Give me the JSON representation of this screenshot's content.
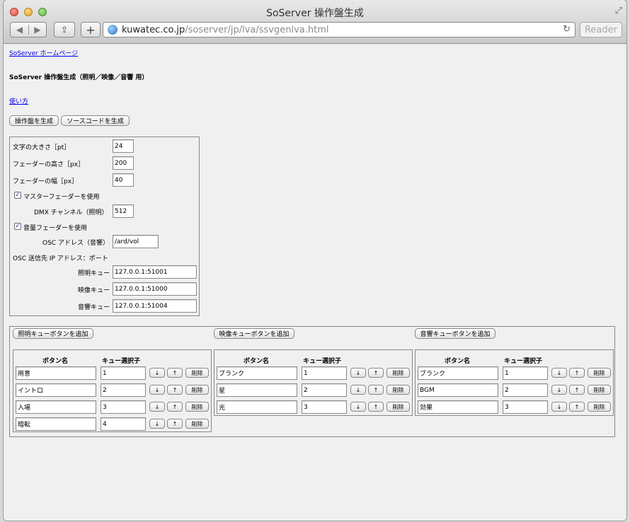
{
  "window": {
    "title": "SoServer 操作盤生成"
  },
  "toolbar": {
    "url_host": "kuwatec.co.jp",
    "url_path": "/soserver/jp/lva/ssvgenlva.html",
    "reader_label": "Reader",
    "add_label": "+",
    "back_glyph": "◀",
    "forward_glyph": "▶"
  },
  "page": {
    "home_link": "SoServer ホームページ",
    "heading": "SoServer 操作盤生成（照明／映像／音響 用）",
    "howto_link": "使い方",
    "generate_panel_button": "操作盤を生成",
    "generate_source_button": "ソースコードを生成"
  },
  "settings": {
    "font_size_label": "文字の大きさ［pt］",
    "font_size_value": "24",
    "fader_height_label": "フェーダーの高さ［px］",
    "fader_height_value": "200",
    "fader_width_label": "フェーダーの幅［px］",
    "fader_width_value": "40",
    "master_fader_label": "マスターフェーダーを使用",
    "master_fader_checked": true,
    "dmx_label": "DMX チャンネル（照明）",
    "dmx_value": "512",
    "volume_fader_label": "音量フェーダーを使用",
    "volume_fader_checked": true,
    "osc_address_label": "OSC アドレス（音響）",
    "osc_address_value": "/ard/vol",
    "osc_dest_label": "OSC 送信先 IP アドレス：ポート",
    "lighting_cue_label": "照明キュー",
    "lighting_cue_value": "127.0.0.1:51001",
    "video_cue_label": "映像キュー",
    "video_cue_value": "127.0.0.1:51000",
    "sound_cue_label": "音響キュー",
    "sound_cue_value": "127.0.0.1:51004",
    "check_glyph": "✓"
  },
  "cue_groups": [
    {
      "add_button": "照明キューボタンを追加",
      "col_name": "ボタン名",
      "col_selector": "キュー選択子",
      "rows": [
        {
          "name": "用意",
          "selector": "1"
        },
        {
          "name": "イントロ",
          "selector": "2"
        },
        {
          "name": "入場",
          "selector": "3"
        },
        {
          "name": "暗転",
          "selector": "4"
        }
      ]
    },
    {
      "add_button": "映像キューボタンを追加",
      "col_name": "ボタン名",
      "col_selector": "キュー選択子",
      "rows": [
        {
          "name": "ブランク",
          "selector": "1"
        },
        {
          "name": "星",
          "selector": "2"
        },
        {
          "name": "光",
          "selector": "3"
        }
      ]
    },
    {
      "add_button": "音響キューボタンを追加",
      "col_name": "ボタン名",
      "col_selector": "キュー選択子",
      "rows": [
        {
          "name": "ブランク",
          "selector": "1"
        },
        {
          "name": "BGM",
          "selector": "2"
        },
        {
          "name": "効果",
          "selector": "3"
        }
      ]
    }
  ],
  "row_buttons": {
    "down": "↓",
    "up": "↑",
    "delete": "削除"
  }
}
